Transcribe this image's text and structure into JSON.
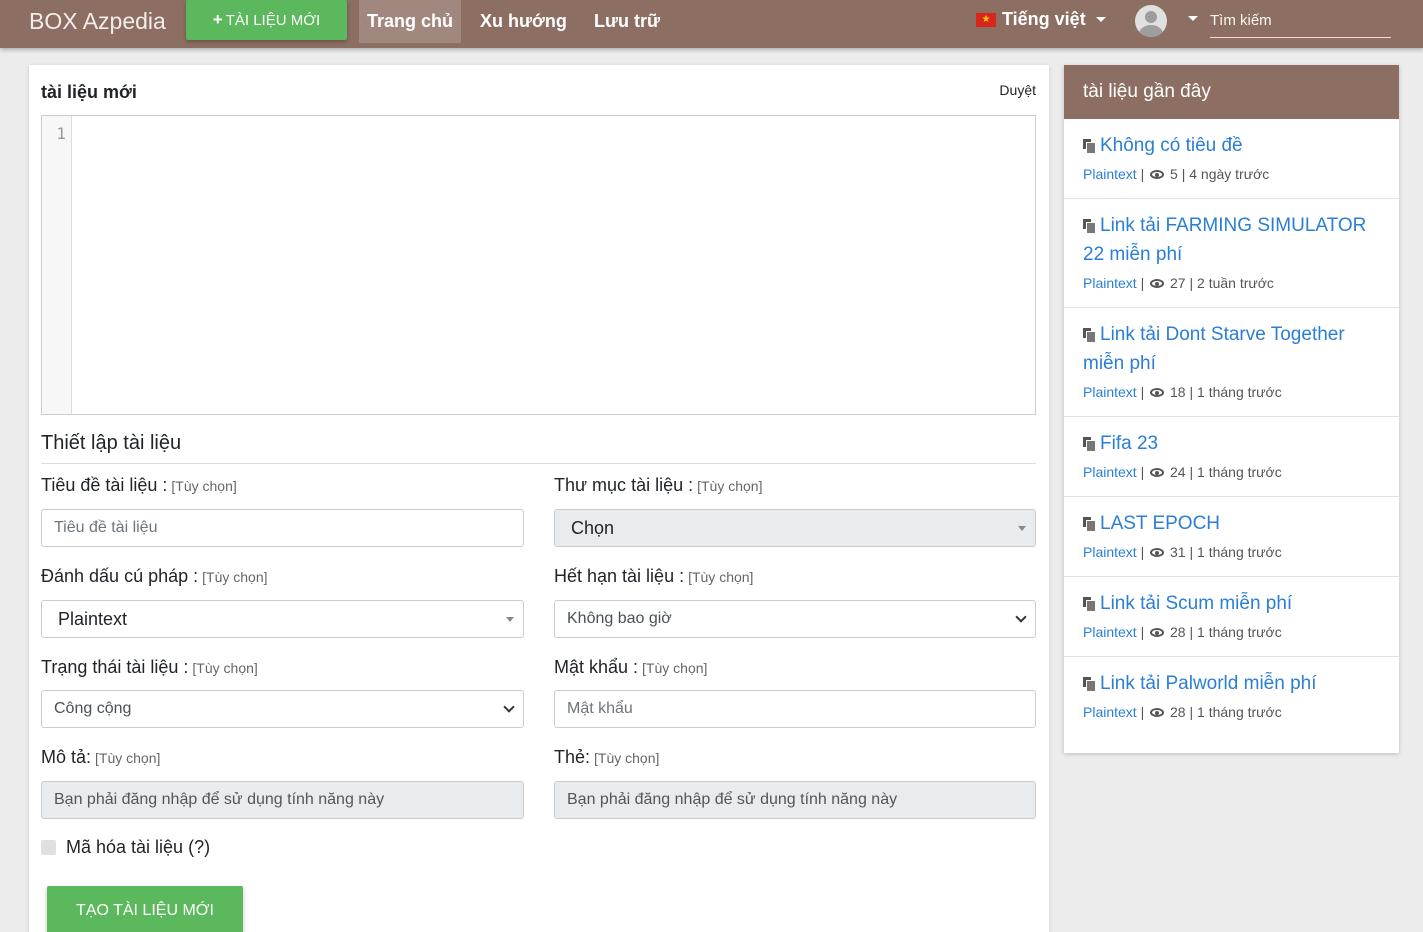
{
  "navbar": {
    "brand": "BOX Azpedia",
    "new_button_label": "TÀI LIỆU MỚI",
    "links": [
      "Trang chủ",
      "Xu hướng",
      "Lưu trữ"
    ],
    "language": "Tiếng việt",
    "search_placeholder": "Tìm kiếm"
  },
  "main": {
    "card_title": "tài liệu mới",
    "browse_link": "Duyệt",
    "editor_line_number": "1",
    "section_title": "Thiết lập tài liệu",
    "optional_tag": "[Tùy chọn]",
    "fields": {
      "title_label": "Tiêu đề tài liệu :",
      "title_placeholder": "Tiêu đề tài liệu",
      "folder_label": "Thư mục tài liệu :",
      "folder_value": "Chọn",
      "syntax_label": "Đánh dấu cú pháp :",
      "syntax_value": "Plaintext",
      "expiry_label": "Hết hạn tài liệu :",
      "expiry_value": "Không bao giờ",
      "status_label": "Trạng thái tài liệu :",
      "status_value": "Công cộng",
      "password_label": "Mật khẩu :",
      "password_placeholder": "Mật khẩu",
      "description_label": "Mô tả:",
      "description_placeholder": "Bạn phải đăng nhập để sử dụng tính năng này",
      "tags_label": "Thẻ:",
      "tags_placeholder": "Bạn phải đăng nhập để sử dụng tính năng này"
    },
    "encrypt_label": "Mã hóa tài liệu (?)",
    "submit_label": "TẠO TÀI LIỆU MỚI"
  },
  "sidebar": {
    "header": "tài liệu gần đây",
    "items": [
      {
        "title": "Không có tiêu đề",
        "lang": "Plaintext",
        "views": "5",
        "time": "4 ngày trước"
      },
      {
        "title": "Link tải FARMING SIMULATOR 22 miễn phí",
        "lang": "Plaintext",
        "views": "27",
        "time": "2 tuần trước"
      },
      {
        "title": "Link tải Dont Starve Together miễn phí",
        "lang": "Plaintext",
        "views": "18",
        "time": "1 tháng trước"
      },
      {
        "title": "Fifa 23",
        "lang": "Plaintext",
        "views": "24",
        "time": "1 tháng trước"
      },
      {
        "title": "LAST EPOCH",
        "lang": "Plaintext",
        "views": "31",
        "time": "1 tháng trước"
      },
      {
        "title": "Link tải Scum miễn phí",
        "lang": "Plaintext",
        "views": "28",
        "time": "1 tháng trước"
      },
      {
        "title": "Link tải Palworld miễn phí",
        "lang": "Plaintext",
        "views": "28",
        "time": "1 tháng trước"
      }
    ]
  }
}
